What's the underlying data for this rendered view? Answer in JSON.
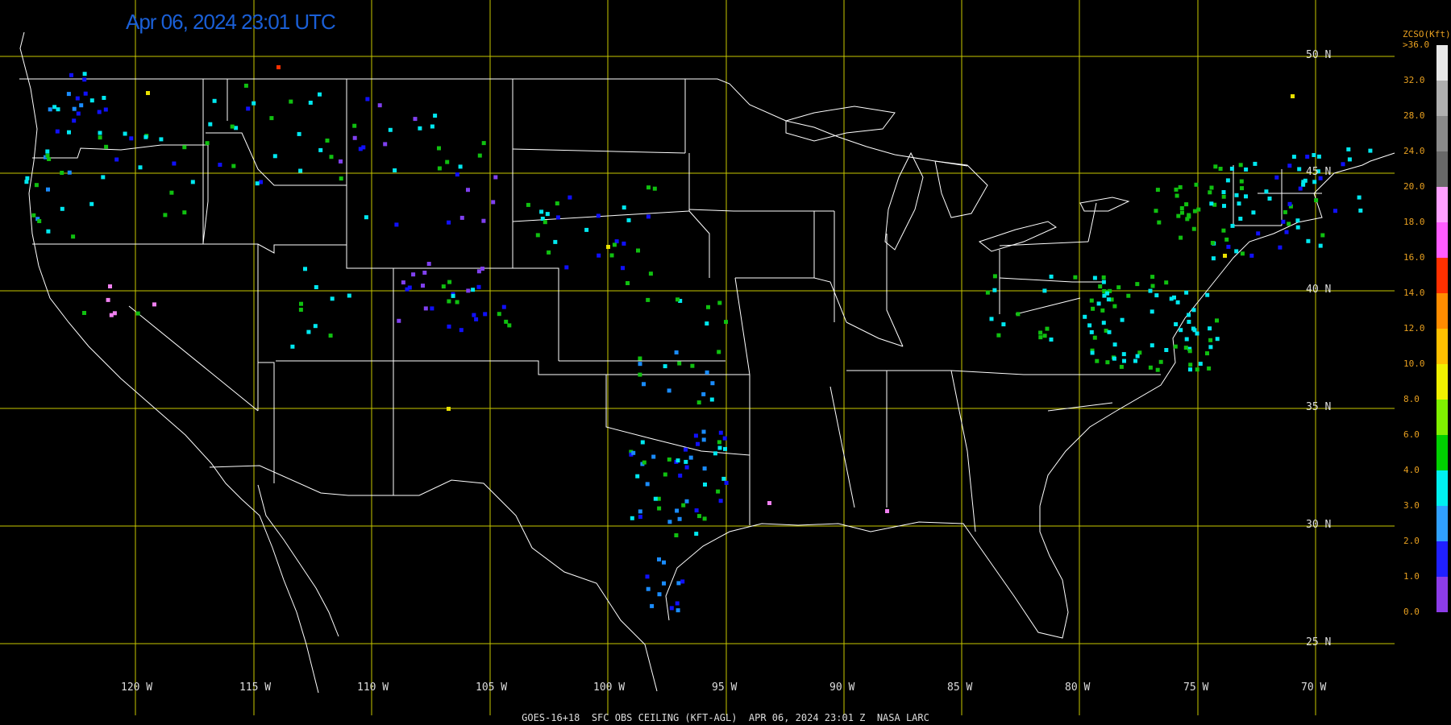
{
  "timestamp": "Apr 06, 2024 23:01 UTC",
  "footer": "GOES-16+18  SFC OBS CEILING (KFT-AGL)  APR 06, 2024 23:01 Z  NASA LARC",
  "lat_labels": [
    "50 N",
    "45 N",
    "40 N",
    "35 N",
    "30 N",
    "25 N"
  ],
  "lon_labels": [
    "120 W",
    "115 W",
    "110 W",
    "105 W",
    "100 W",
    "95 W",
    "90 W",
    "85 W",
    "80 W",
    "75 W",
    "70 W"
  ],
  "legend": {
    "title_line1": "ZCSO(Kft)",
    "title_line2": ">36.0",
    "labels": [
      "32.0",
      "28.0",
      "24.0",
      "20.0",
      "18.0",
      "16.0",
      "14.0",
      "12.0",
      "10.0",
      "8.0",
      "6.0",
      "4.0",
      "3.0",
      "2.0",
      "1.0",
      "0.0"
    ],
    "colors": [
      "#e8e8e8",
      "#b0b0b0",
      "#8a8a8a",
      "#686868",
      "#ffa0ff",
      "#ff5cff",
      "#ff3000",
      "#ff8c00",
      "#ffc000",
      "#f0f000",
      "#80f000",
      "#00d000",
      "#00f0f0",
      "#30a0ff",
      "#2020ff",
      "#8c3ce8"
    ]
  },
  "colors": {
    "grid": "#c8c800",
    "borders": "#ffffff",
    "ceiling_0_1": "#1010ff",
    "ceiling_1_3": "#1a8cff",
    "ceiling_3_6": "#00e8f0",
    "ceiling_6_10": "#10c010",
    "ceiling_10_16": "#e8e000",
    "ceiling_20_24": "#f080f0",
    "ceiling_clear": "#8040f0"
  }
}
